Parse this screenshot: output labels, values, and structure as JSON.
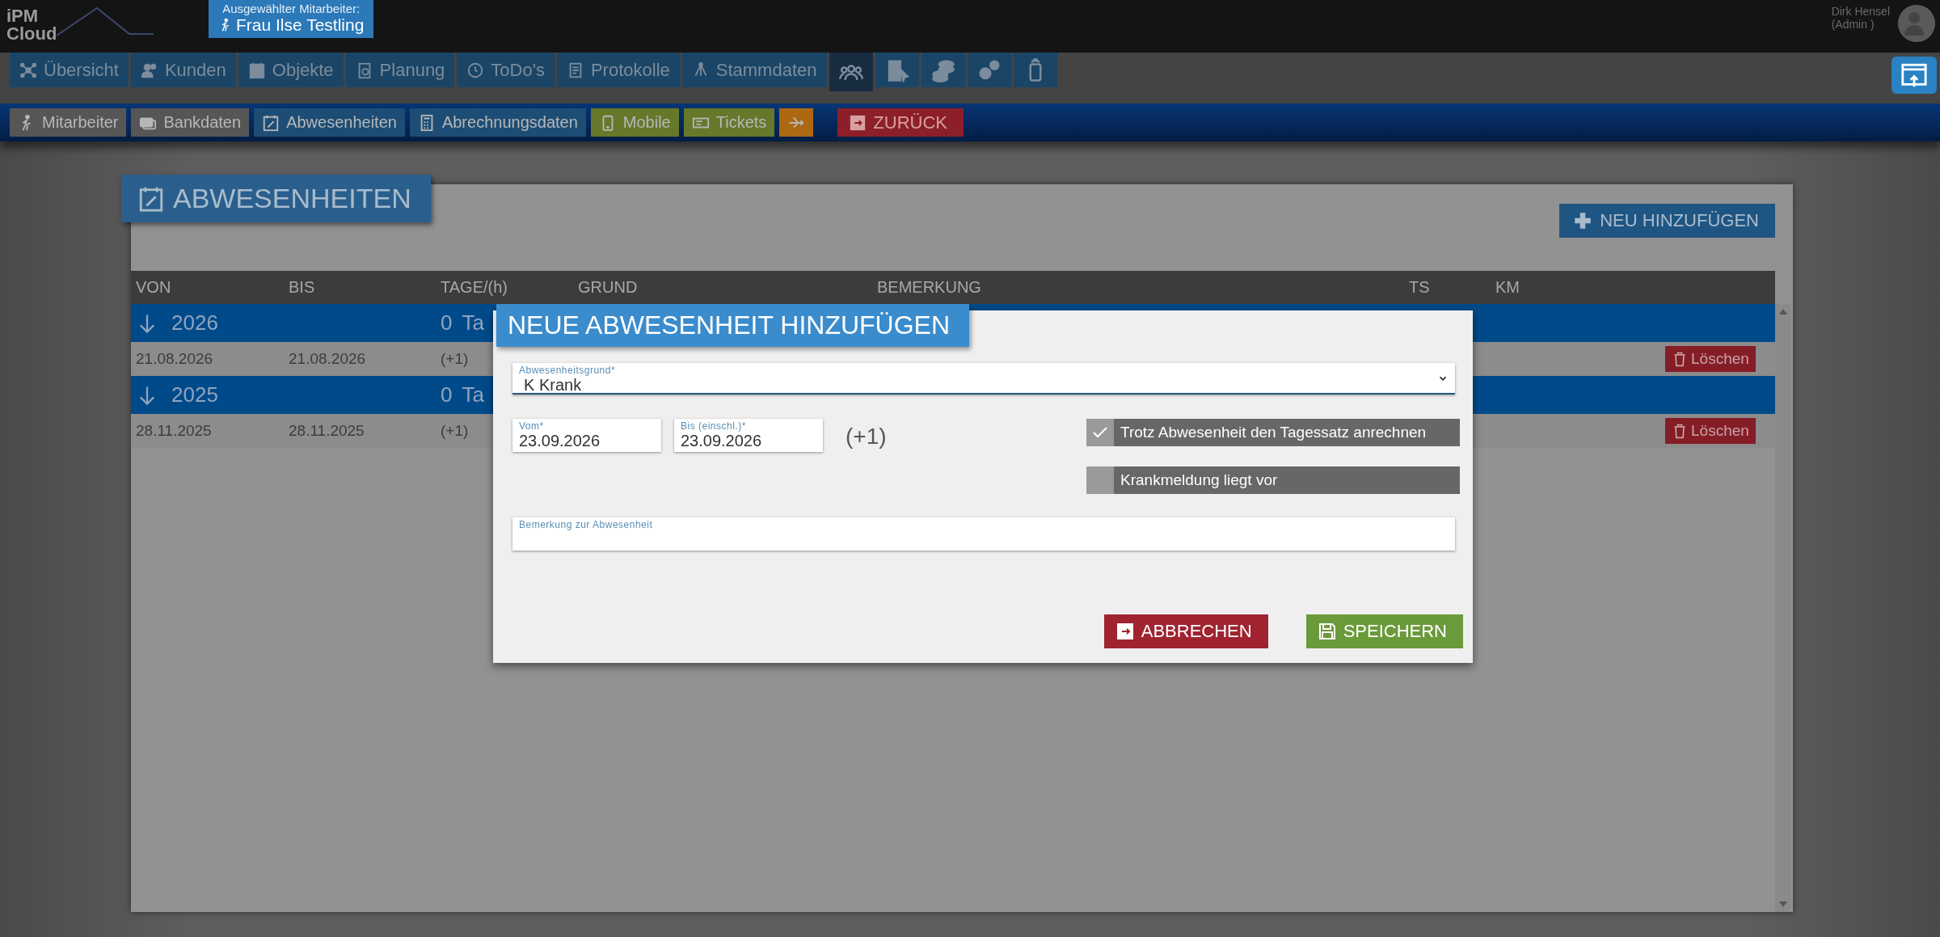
{
  "header": {
    "logo": [
      "iPM",
      "Cloud"
    ],
    "selected_employee": {
      "label": "Ausgewählter Mitarbeiter:",
      "name": "Frau Ilse Testling"
    },
    "user": {
      "name": "Dirk Hensel",
      "role": "(Admin )"
    }
  },
  "main_nav": [
    {
      "label": "Übersicht",
      "selected": false
    },
    {
      "label": "Kunden",
      "selected": false
    },
    {
      "label": "Objekte",
      "selected": false
    },
    {
      "label": "Planung",
      "selected": false
    },
    {
      "label": "ToDo's",
      "selected": false
    },
    {
      "label": "Protokolle",
      "selected": false
    },
    {
      "label": "Stammdaten",
      "selected": false
    },
    {
      "selected": true
    },
    {
      "selected": false
    },
    {
      "selected": false
    },
    {
      "selected": false
    },
    {
      "selected": false
    }
  ],
  "sub_nav": [
    {
      "label": "Mitarbeiter",
      "color": "#565656"
    },
    {
      "label": "Bankdaten",
      "color": "#565656"
    },
    {
      "label": "Abwesenheiten",
      "color": "#1d4d75"
    },
    {
      "label": "Abrechnungsdaten",
      "color": "#1d4d75"
    },
    {
      "label": "Mobile",
      "color": "#66782a"
    },
    {
      "label": "Tickets",
      "color": "#66782a"
    },
    {
      "color": "#ad6812"
    },
    {
      "label": "ZURÜCK",
      "color": "#8c1f29"
    }
  ],
  "page": {
    "title": "ABWESENHEITEN",
    "add_button": "NEU HINZUFÜGEN",
    "table": {
      "columns": [
        "VON",
        "BIS",
        "TAGE/(h)",
        "GRUND",
        "BEMERKUNG",
        "TS",
        "KM"
      ],
      "groups": [
        {
          "year": "2026",
          "days": "0",
          "days_unit": "Ta",
          "rows": [
            {
              "from": "21.08.2026",
              "to": "21.08.2026",
              "days": "(+1)",
              "delete": "Löschen"
            }
          ]
        },
        {
          "year": "2025",
          "days": "0",
          "days_unit": "Ta",
          "rows": [
            {
              "from": "28.11.2025",
              "to": "28.11.2025",
              "days": "(+1)",
              "delete": "Löschen"
            }
          ]
        }
      ]
    }
  },
  "dialog": {
    "title": "NEUE ABWESENHEIT HINZUFÜGEN",
    "reason": {
      "label": "Abwesenheitsgrund*",
      "value": "K Krank"
    },
    "from": {
      "label": "Vom*",
      "value": "23.09.2026"
    },
    "to": {
      "label": "Bis (einschl.)*",
      "value": "23.09.2026"
    },
    "days": "(+1)",
    "options": [
      {
        "label": "Trotz Abwesenheit den Tagessatz anrechnen",
        "checked": true
      },
      {
        "label": "Krankmeldung liegt vor",
        "checked": false
      }
    ],
    "remark": {
      "label": "Bemerkung zur Abwesenheit"
    },
    "buttons": [
      {
        "label": "ABBRECHEN",
        "kind": "cancel"
      },
      {
        "label": "SPEICHERN",
        "kind": "save"
      }
    ]
  }
}
